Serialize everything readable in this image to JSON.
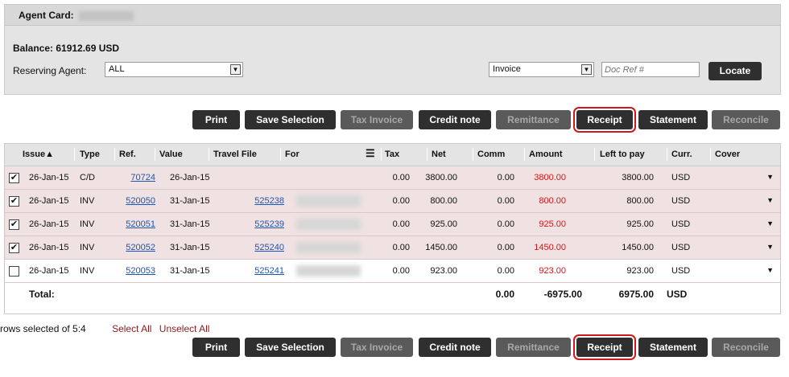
{
  "header": {
    "agent_card_label": "Agent Card:"
  },
  "balance": "Balance: 61912.69 USD",
  "reserving_agent": {
    "label": "Reserving Agent:",
    "value": "ALL"
  },
  "doc_type": {
    "value": "Invoice"
  },
  "doc_ref": {
    "placeholder": "Doc Ref #"
  },
  "locate_label": "Locate",
  "actions": {
    "print": "Print",
    "save_selection": "Save Selection",
    "tax_invoice": "Tax Invoice",
    "credit_note": "Credit note",
    "remittance": "Remittance",
    "receipt": "Receipt",
    "statement": "Statement",
    "reconcile": "Reconcile"
  },
  "columns": {
    "issue": "Issue▲",
    "type": "Type",
    "ref": "Ref.",
    "value": "Value",
    "travel_file": "Travel File",
    "for": "For",
    "tax": "Tax",
    "net": "Net",
    "comm": "Comm",
    "amount": "Amount",
    "left_to_pay": "Left to pay",
    "curr": "Curr.",
    "cover": "Cover"
  },
  "rows": [
    {
      "checked": true,
      "issue": "26-Jan-15",
      "type": "C/D",
      "ref": "70724",
      "value": "26-Jan-15",
      "travel_file": "",
      "tax": "0.00",
      "net": "3800.00",
      "comm": "0.00",
      "amount": "3800.00",
      "left": "3800.00",
      "curr": "USD",
      "cover": "▼"
    },
    {
      "checked": true,
      "issue": "26-Jan-15",
      "type": "INV",
      "ref": "520050",
      "value": "31-Jan-15",
      "travel_file": "525238",
      "tax": "0.00",
      "net": "800.00",
      "comm": "0.00",
      "amount": "800.00",
      "left": "800.00",
      "curr": "USD",
      "cover": "▼"
    },
    {
      "checked": true,
      "issue": "26-Jan-15",
      "type": "INV",
      "ref": "520051",
      "value": "31-Jan-15",
      "travel_file": "525239",
      "tax": "0.00",
      "net": "925.00",
      "comm": "0.00",
      "amount": "925.00",
      "left": "925.00",
      "curr": "USD",
      "cover": "▼"
    },
    {
      "checked": true,
      "issue": "26-Jan-15",
      "type": "INV",
      "ref": "520052",
      "value": "31-Jan-15",
      "travel_file": "525240",
      "tax": "0.00",
      "net": "1450.00",
      "comm": "0.00",
      "amount": "1450.00",
      "left": "1450.00",
      "curr": "USD",
      "cover": "▼"
    },
    {
      "checked": false,
      "issue": "26-Jan-15",
      "type": "INV",
      "ref": "520053",
      "value": "31-Jan-15",
      "travel_file": "525241",
      "tax": "0.00",
      "net": "923.00",
      "comm": "0.00",
      "amount": "923.00",
      "left": "923.00",
      "curr": "USD",
      "cover": "▼"
    }
  ],
  "totals": {
    "label": "Total:",
    "comm": "0.00",
    "amount": "-6975.00",
    "left": "6975.00",
    "curr": "USD"
  },
  "footer": {
    "rows_selected": "rows selected of 5:4",
    "select_all": "Select All",
    "unselect_all": "Unselect All"
  },
  "colors": {
    "accent_red": "#d01818",
    "selected_row": "#f0e2e2",
    "link_blue": "#1a55b8"
  }
}
